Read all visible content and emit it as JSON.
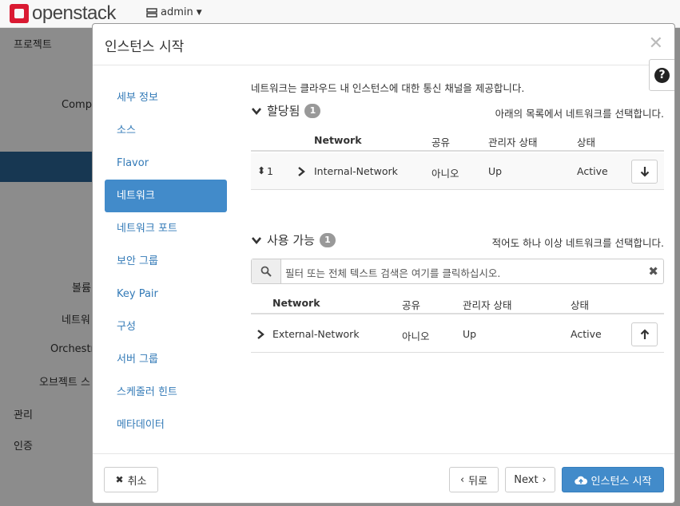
{
  "app": {
    "logo_text": "openstack",
    "user_menu": "admin"
  },
  "background_nav": {
    "project": "프로젝트",
    "compute": "Compu",
    "volume": "볼륨",
    "network": "네트워",
    "orchestration": "Orchestra",
    "object_store": "오브젝트 스",
    "admin": "관리",
    "identity": "인증"
  },
  "modal": {
    "title": "인스턴스 시작",
    "nav": [
      {
        "label": "세부 정보"
      },
      {
        "label": "소스"
      },
      {
        "label": "Flavor"
      },
      {
        "label": "네트워크"
      },
      {
        "label": "네트워크 포트"
      },
      {
        "label": "보안 그룹"
      },
      {
        "label": "Key Pair"
      },
      {
        "label": "구성"
      },
      {
        "label": "서버 그룹"
      },
      {
        "label": "스케줄러 힌트"
      },
      {
        "label": "메타데이터"
      }
    ],
    "active_nav_index": 3,
    "intro": "네트워크는 클라우드 내 인스턴스에 대한 통신 채널을 제공합니다.",
    "allocated": {
      "title": "할당됨",
      "count": "1",
      "hint": "아래의 목록에서 네트워크를 선택합니다.",
      "columns": [
        "Network",
        "공유",
        "관리자 상태",
        "상태"
      ],
      "rows": [
        {
          "order": "1",
          "network": "Internal-Network",
          "shared": "아니오",
          "admin_state": "Up",
          "status": "Active"
        }
      ]
    },
    "available": {
      "title": "사용 가능",
      "count": "1",
      "hint": "적어도 하나 이상 네트워크를 선택합니다.",
      "search_placeholder": "필터 또는 전체 텍스트 검색은 여기를 클릭하십시오.",
      "columns": [
        "Network",
        "공유",
        "관리자 상태",
        "상태"
      ],
      "rows": [
        {
          "network": "External-Network",
          "shared": "아니오",
          "admin_state": "Up",
          "status": "Active"
        }
      ]
    },
    "footer": {
      "cancel": "취소",
      "back": "뒤로",
      "next": "Next",
      "launch": "인스턴스 시작"
    }
  }
}
